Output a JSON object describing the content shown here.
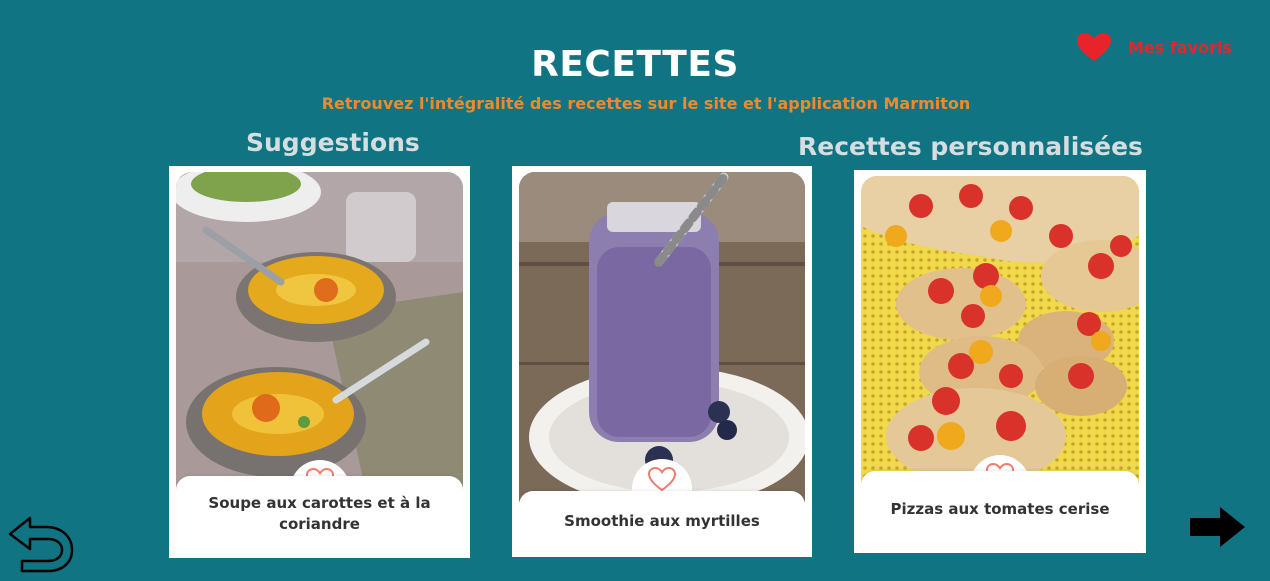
{
  "header": {
    "title": "RECETTES",
    "subtitle": "Retrouvez l'intégralité des recettes sur le site et l'application Marmiton"
  },
  "favorites": {
    "label": "Mes favoris",
    "icon": "heart-icon",
    "color": "#e8242a"
  },
  "sections": {
    "suggestions": "Suggestions",
    "personalized": "Recettes personnalisées"
  },
  "cards": [
    {
      "title": "Soupe aux carottes et à la coriandre",
      "image": "carrot-soup-photo"
    },
    {
      "title": "Smoothie aux myrtilles",
      "image": "blueberry-smoothie-photo"
    },
    {
      "title": "Pizzas aux tomates cerise",
      "image": "cherry-tomato-pizza-photo"
    }
  ],
  "navigation": {
    "back_icon": "back-arrow-icon",
    "next_icon": "next-arrow-icon"
  },
  "colors": {
    "background": "#117482",
    "subtitle": "#ee8a2c",
    "section_label": "#d6dde0",
    "heart_outline": "#f07c6e"
  }
}
